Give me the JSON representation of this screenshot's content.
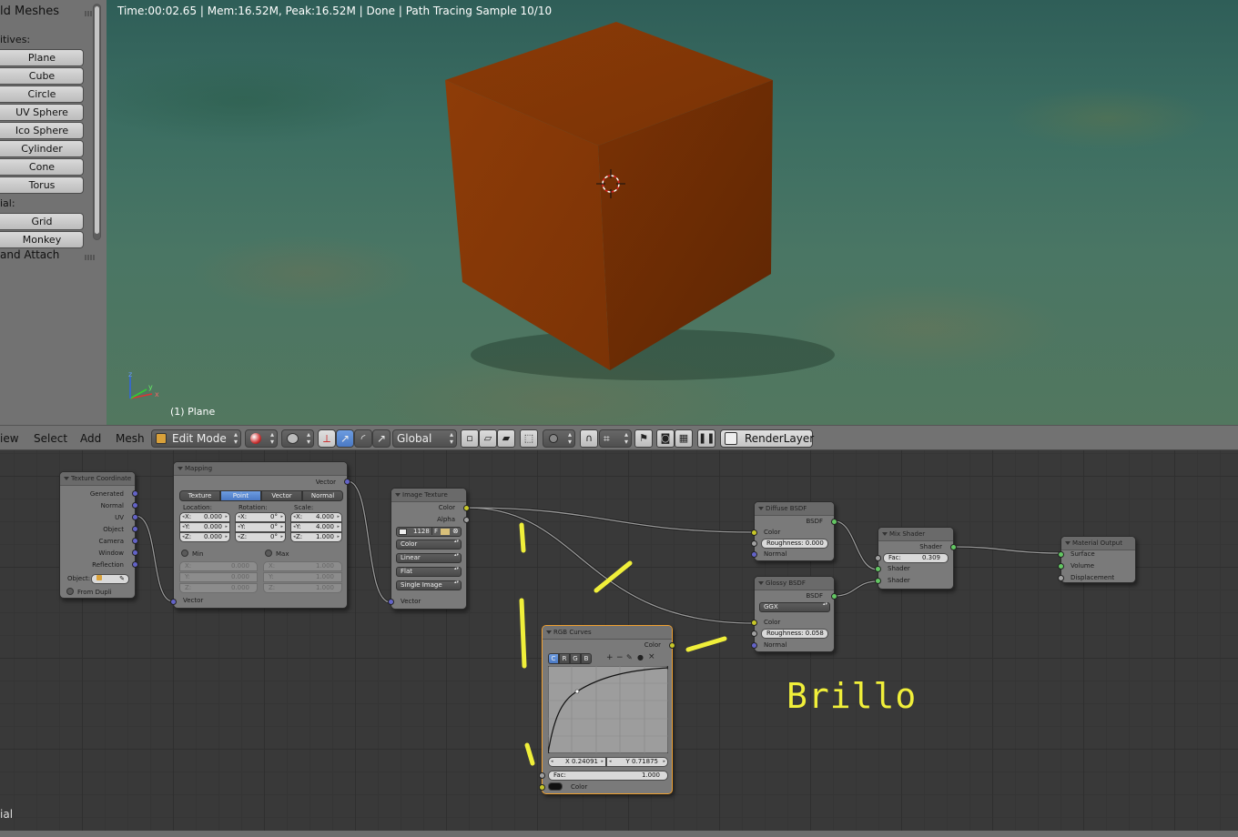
{
  "toolshelf": {
    "header_add_meshes": "ld Meshes",
    "cat_primitives": "itives:",
    "primitives": [
      "Plane",
      "Cube",
      "Circle",
      "UV Sphere",
      "Ico Sphere",
      "Cylinder",
      "Cone",
      "Torus"
    ],
    "cat_special": "ial:",
    "special": [
      "Grid",
      "Monkey"
    ],
    "header_join": "and Attach"
  },
  "viewport": {
    "info": "Time:00:02.65 | Mem:16.52M, Peak:16.52M | Done | Path Tracing Sample 10/10",
    "object_label": "(1) Plane",
    "axis": {
      "x": "x",
      "y": "y",
      "z": "z"
    }
  },
  "header": {
    "menus": {
      "view": "iew",
      "select": "Select",
      "add": "Add",
      "mesh": "Mesh"
    },
    "mode": "Edit Mode",
    "orientation": "Global",
    "render_layer": "RenderLayer"
  },
  "node_editor": {
    "side_label": "ial",
    "nodes": {
      "texcoord": {
        "title": "Texture Coordinate",
        "outputs": [
          "Generated",
          "Normal",
          "UV",
          "Object",
          "Camera",
          "Window",
          "Reflection"
        ],
        "object_label": "Object:",
        "from_dupli": "From Dupli"
      },
      "mapping": {
        "title": "Mapping",
        "vector_out": "Vector",
        "tabs": [
          "Texture",
          "Point",
          "Vector",
          "Normal"
        ],
        "active_tab": "Point",
        "location_label": "Location:",
        "rotation_label": "Rotation:",
        "scale_label": "Scale:",
        "location": [
          {
            "axis": "X:",
            "val": "0.000"
          },
          {
            "axis": "Y:",
            "val": "0.000"
          },
          {
            "axis": "Z:",
            "val": "0.000"
          }
        ],
        "rotation": [
          {
            "axis": "X:",
            "val": "0°"
          },
          {
            "axis": "Y:",
            "val": "0°"
          },
          {
            "axis": "Z:",
            "val": "0°"
          }
        ],
        "scale": [
          {
            "axis": "X:",
            "val": "4.000"
          },
          {
            "axis": "Y:",
            "val": "4.000"
          },
          {
            "axis": "Z:",
            "val": "1.000"
          }
        ],
        "min_label": "Min",
        "max_label": "Max",
        "min": [
          {
            "axis": "X:",
            "val": "0.000"
          },
          {
            "axis": "Y:",
            "val": "0.000"
          },
          {
            "axis": "Z:",
            "val": "0.000"
          }
        ],
        "max": [
          {
            "axis": "X:",
            "val": "1.000"
          },
          {
            "axis": "Y:",
            "val": "1.000"
          },
          {
            "axis": "Z:",
            "val": "1.000"
          }
        ],
        "vector_in": "Vector"
      },
      "image_texture": {
        "title": "Image Texture",
        "color_out": "Color",
        "alpha_out": "Alpha",
        "image_users": "1128",
        "fake_user": "F",
        "color_space": "Color",
        "interpolation": "Linear",
        "projection": "Flat",
        "source": "Single Image",
        "vector_in": "Vector"
      },
      "diffuse": {
        "title": "Diffuse BSDF",
        "out": "BSDF",
        "color": "Color",
        "roughness_label": "Roughness:",
        "roughness": "0.000",
        "normal": "Normal"
      },
      "glossy": {
        "title": "Glossy BSDF",
        "out": "BSDF",
        "distribution": "GGX",
        "color": "Color",
        "roughness_label": "Roughness:",
        "roughness": "0.058",
        "normal": "Normal"
      },
      "mix": {
        "title": "Mix Shader",
        "out": "Shader",
        "fac_label": "Fac:",
        "fac": "0.309",
        "shader1": "Shader",
        "shader2": "Shader"
      },
      "output": {
        "title": "Material Output",
        "surface": "Surface",
        "volume": "Volume",
        "displacement": "Displacement"
      },
      "rgb_curves": {
        "title": "RGB Curves",
        "color_out": "Color",
        "channels": [
          "C",
          "R",
          "G",
          "B"
        ],
        "active_channel": "C",
        "x_value": "X 0.24091",
        "y_value": "Y 0.71875",
        "fac_label": "Fac:",
        "fac": "1.000",
        "color_in": "Color"
      }
    },
    "annotation_text": "Brillo"
  }
}
